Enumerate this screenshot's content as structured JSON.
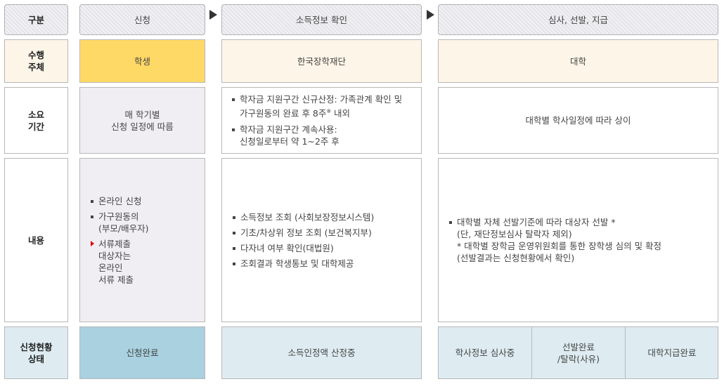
{
  "headers": {
    "label": "구분",
    "col1": "신청",
    "col2": "소득정보 확인",
    "col3": "심사, 선발, 지급"
  },
  "performer": {
    "label": "수행\n주체",
    "col1": "학생",
    "col2": "한국장학재단",
    "col3": "대학"
  },
  "duration": {
    "label": "소요\n기간",
    "col1": "매 학기별\n신청 일정에 따름",
    "col2": [
      {
        "text": "학자금 지원구간 신규산정: 가족관계 확인 및\n가구원동의 완료 후 8주",
        "sup": "※",
        "tail": " 내외"
      },
      {
        "text": "학자금 지원구간 계속사용:\n신청일로부터 약 1~2주 후"
      }
    ],
    "col3": "대학별 학사일정에 따라 상이"
  },
  "content": {
    "label": "내용",
    "col1": [
      "온라인 신청",
      "가구원동의\n(부모/배우자)",
      "서류제출\n대상자는\n온라인\n서류 제출"
    ],
    "col2": [
      "소득정보 조회 (사회보장정보시스템)",
      "기초/차상위 정보 조회 (보건복지부)",
      "다자녀 여부 확인(대법원)",
      "조회결과 학생통보 및 대학제공"
    ],
    "col3": "대학별 자체 선발기준에 따라 대상자 선발 *\n(단, 재단정보심사 탈락자 제외)\n* 대학별 장학금 운영위원회를 통한 장학생 심의 및 확정\n(선발결과는 신청현황에서 확인)"
  },
  "status": {
    "label": "신청현황\n상태",
    "col1": "신청완료",
    "col2": "소득인정액 산정중",
    "col3": [
      "학사정보 심사중",
      "선발완료\n/탈락(사유)",
      "대학지급완료"
    ]
  },
  "colors": {
    "performer_student": "#ffd966",
    "status_done": "#a9d1df",
    "status_other": "#deecf2",
    "bullet_highlight": "#dd0000"
  }
}
